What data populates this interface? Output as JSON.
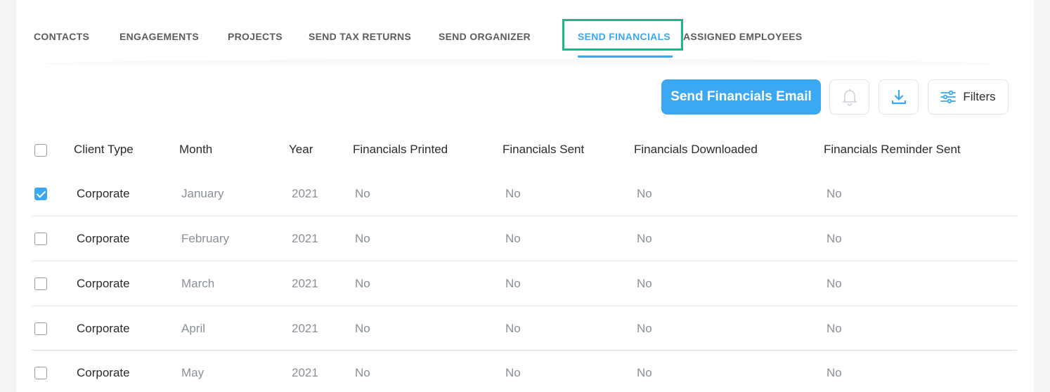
{
  "tabs": [
    {
      "label": "CONTACTS"
    },
    {
      "label": "ENGAGEMENTS"
    },
    {
      "label": "PROJECTS"
    },
    {
      "label": "SEND TAX RETURNS"
    },
    {
      "label": "SEND ORGANIZER"
    },
    {
      "label": "SEND FINANCIALS",
      "active": true
    },
    {
      "label": "ASSIGNED EMPLOYEES"
    }
  ],
  "toolbar": {
    "send_email_label": "Send Financials Email",
    "filters_label": "Filters"
  },
  "table": {
    "headers": [
      "Client Type",
      "Month",
      "Year",
      "Financials Printed",
      "Financials Sent",
      "Financials Downloaded",
      "Financials Reminder Sent"
    ],
    "rows": [
      {
        "checked": true,
        "cells": [
          "Corporate",
          "January",
          "2021",
          "No",
          "No",
          "No",
          "No"
        ]
      },
      {
        "checked": false,
        "cells": [
          "Corporate",
          "February",
          "2021",
          "No",
          "No",
          "No",
          "No"
        ]
      },
      {
        "checked": false,
        "cells": [
          "Corporate",
          "March",
          "2021",
          "No",
          "No",
          "No",
          "No"
        ]
      },
      {
        "checked": false,
        "cells": [
          "Corporate",
          "April",
          "2021",
          "No",
          "No",
          "No",
          "No"
        ]
      },
      {
        "checked": false,
        "cells": [
          "Corporate",
          "May",
          "2021",
          "No",
          "No",
          "No",
          "No"
        ]
      }
    ]
  },
  "colors": {
    "accent": "#3aa8f3",
    "highlight": "#18b98a"
  }
}
